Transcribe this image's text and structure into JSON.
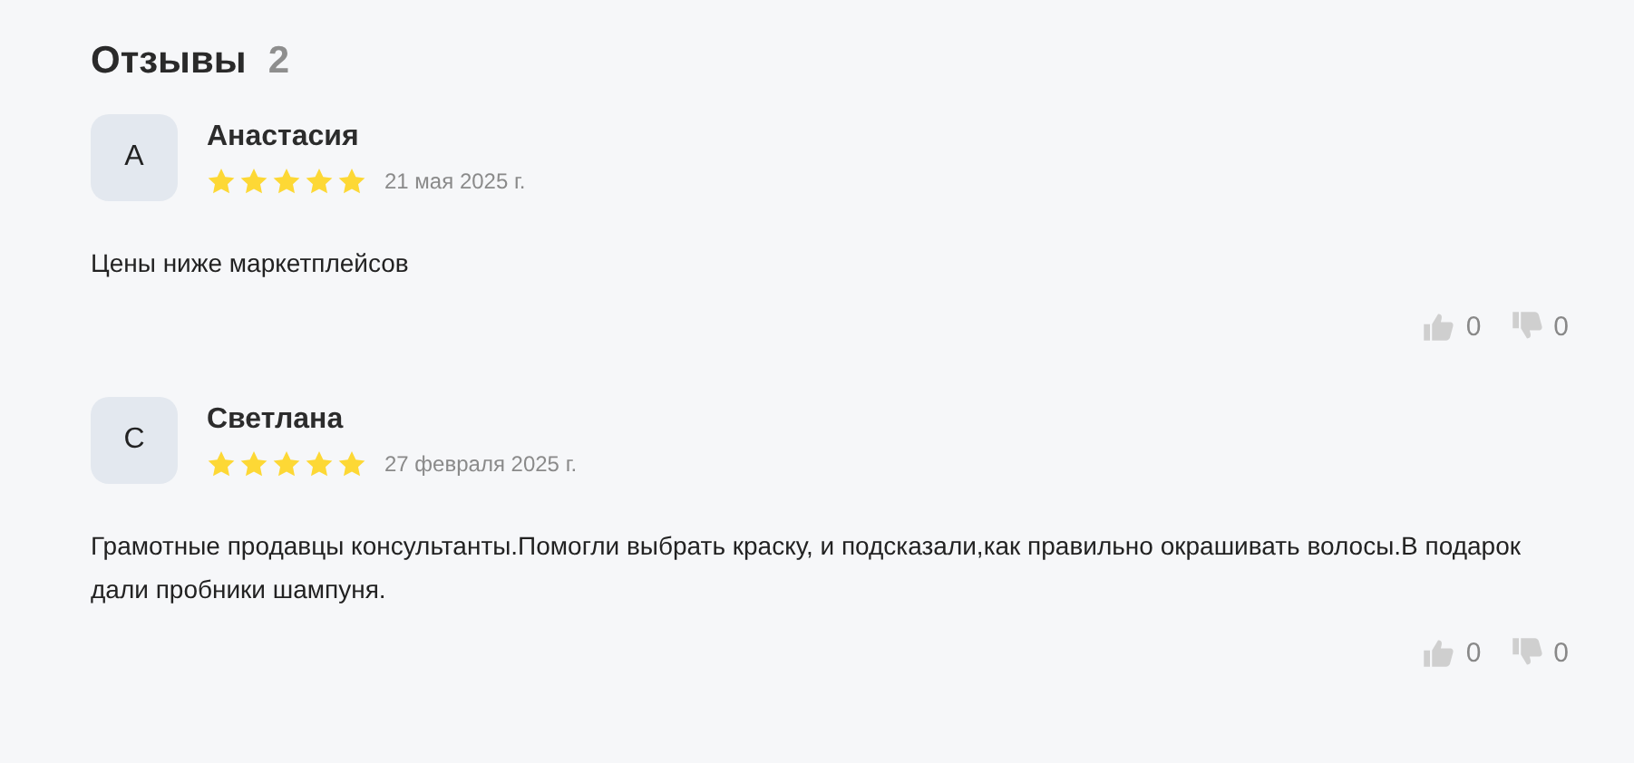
{
  "title": "Отзывы",
  "count": "2",
  "reviews": [
    {
      "initial": "А",
      "name": "Анастасия",
      "stars": 5,
      "date": "21 мая 2025 г.",
      "text": "Цены ниже маркетплейсов",
      "likes": "0",
      "dislikes": "0"
    },
    {
      "initial": "С",
      "name": "Светлана",
      "stars": 5,
      "date": "27 февраля 2025 г.",
      "text": "Грамотные продавцы консультанты.Помогли выбрать краску, и подсказали,как правильно окрашивать волосы.В подарок дали пробники шампуня.",
      "likes": "0",
      "dislikes": "0"
    }
  ]
}
